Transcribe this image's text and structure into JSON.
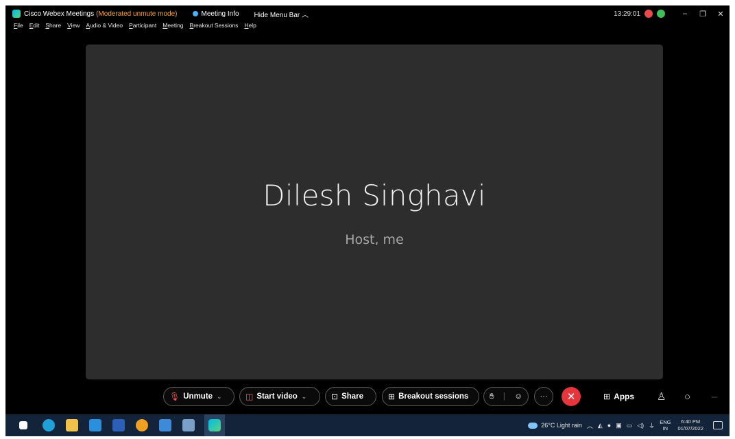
{
  "titlebar": {
    "app_name": "Cisco Webex Meetings",
    "mode": "(Moderated unmute mode)",
    "meeting_info": "Meeting Info",
    "hide_menu": "Hide Menu Bar ︿",
    "clock": "13:29:01",
    "minimize": "–",
    "restore": "❐",
    "close": "✕"
  },
  "menu": [
    "File",
    "Edit",
    "Share",
    "View",
    "Audio & Video",
    "Participant",
    "Meeting",
    "Breakout Sessions",
    "Help"
  ],
  "participant": {
    "name": "Dilesh Singhavi",
    "role": "Host, me"
  },
  "controls": {
    "unmute": "Unmute",
    "start_video": "Start video",
    "share": "Share",
    "breakout": "Breakout sessions",
    "more": "···",
    "end": "✕",
    "apps": "Apps"
  },
  "taskbar": {
    "weather": "26°C  Light rain",
    "lang_top": "ENG",
    "lang_bottom": "IN",
    "time": "6:40 PM",
    "date": "01/07/2022"
  },
  "colors": {
    "accent_mode": "#f3a43b",
    "end_button": "#e5353d",
    "stage": "#2d2d2d",
    "taskbar": "#13243a"
  }
}
